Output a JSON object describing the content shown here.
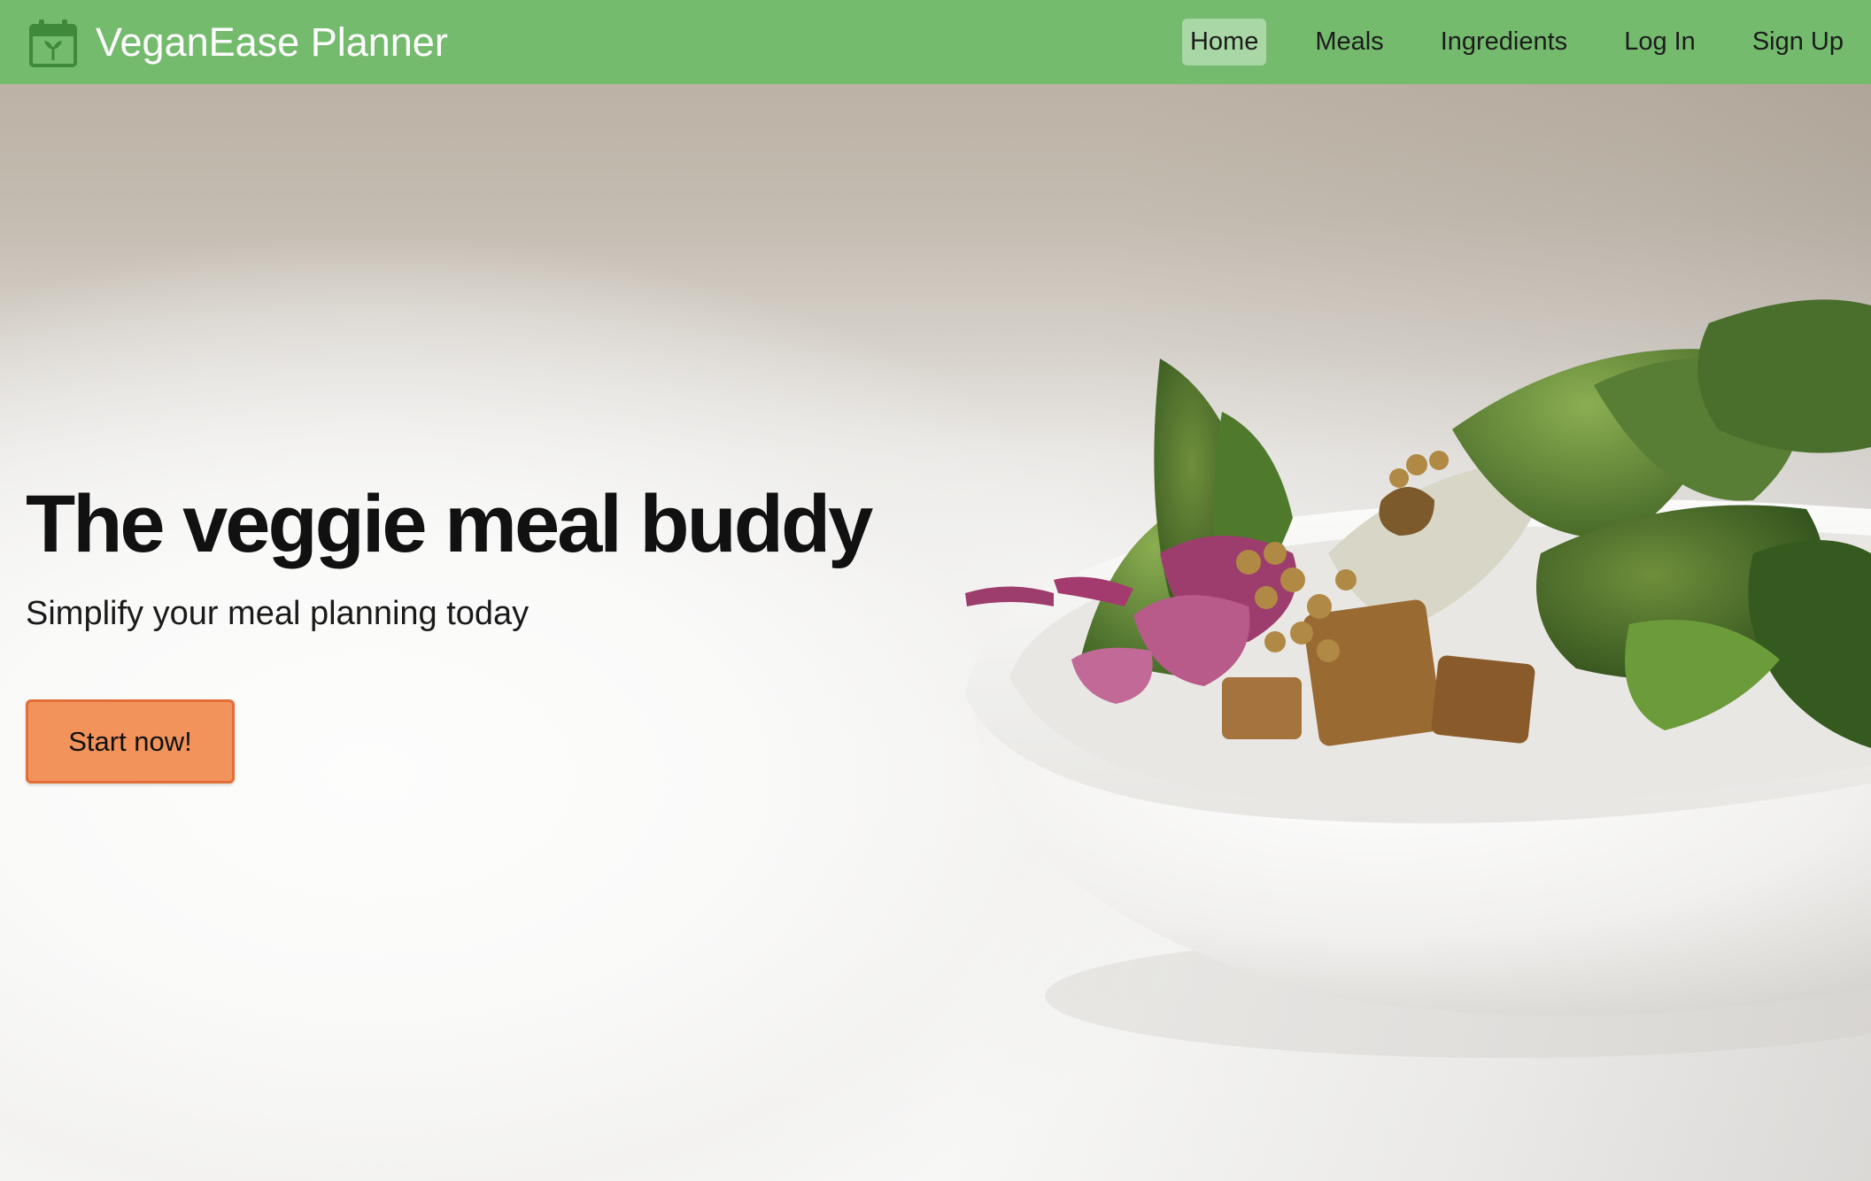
{
  "brand": {
    "name": "VeganEase Planner",
    "icon": "calendar-sprout-icon",
    "icon_color": "#3f8a3a"
  },
  "nav": {
    "items": [
      {
        "label": "Home",
        "active": true
      },
      {
        "label": "Meals",
        "active": false
      },
      {
        "label": "Ingredients",
        "active": false
      },
      {
        "label": "Log In",
        "active": false
      },
      {
        "label": "Sign Up",
        "active": false
      }
    ]
  },
  "hero": {
    "title": "The veggie meal buddy",
    "subtitle": "Simplify your meal planning today",
    "cta_label": "Start now!",
    "image": "salad-bowl-photo"
  },
  "colors": {
    "navbar_bg": "#74bb6e",
    "nav_active_bg": "#a9d7a5",
    "cta_bg": "#f2935c",
    "cta_border": "#e36e37"
  }
}
